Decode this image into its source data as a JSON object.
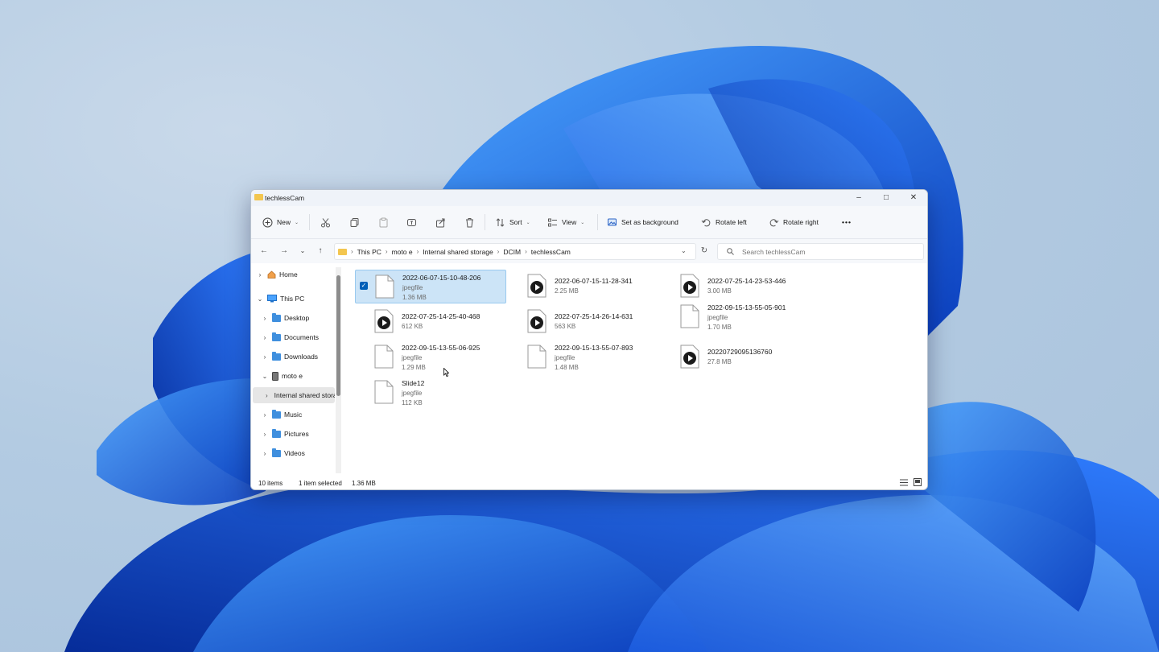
{
  "window": {
    "title": "techlessCam"
  },
  "toolbar": {
    "new_label": "New",
    "sort_label": "Sort",
    "view_label": "View",
    "set_background_label": "Set as background",
    "rotate_left_label": "Rotate left",
    "rotate_right_label": "Rotate right",
    "more_label": "•••"
  },
  "address": {
    "crumbs": [
      "This PC",
      "moto e",
      "Internal shared storage",
      "DCIM",
      "techlessCam"
    ]
  },
  "search": {
    "placeholder": "Search techlessCam"
  },
  "sidebar": {
    "items": [
      {
        "label": "Home",
        "icon": "home-icon"
      },
      {
        "label": "This PC",
        "icon": "computer-icon"
      },
      {
        "label": "Desktop",
        "icon": "folder-icon"
      },
      {
        "label": "Documents",
        "icon": "folder-icon"
      },
      {
        "label": "Downloads",
        "icon": "folder-icon"
      },
      {
        "label": "moto e",
        "icon": "phone-icon"
      },
      {
        "label": "Internal shared storage",
        "icon": "storage-icon"
      },
      {
        "label": "Music",
        "icon": "folder-icon"
      },
      {
        "label": "Pictures",
        "icon": "folder-icon"
      },
      {
        "label": "Videos",
        "icon": "folder-icon"
      }
    ]
  },
  "files": [
    {
      "name": "2022-06-07-15-10-48-206",
      "type": "jpegfile",
      "size": "1.36 MB",
      "kind": "image",
      "selected": true
    },
    {
      "name": "2022-06-07-15-11-28-341",
      "type": "",
      "size": "2.25 MB",
      "kind": "video"
    },
    {
      "name": "2022-07-25-14-23-53-446",
      "type": "",
      "size": "3.00 MB",
      "kind": "video"
    },
    {
      "name": "2022-07-25-14-25-40-468",
      "type": "",
      "size": "612 KB",
      "kind": "video"
    },
    {
      "name": "2022-07-25-14-26-14-631",
      "type": "",
      "size": "563 KB",
      "kind": "video"
    },
    {
      "name": "2022-09-15-13-55-05-901",
      "type": "jpegfile",
      "size": "1.70 MB",
      "kind": "image"
    },
    {
      "name": "2022-09-15-13-55-06-925",
      "type": "jpegfile",
      "size": "1.29 MB",
      "kind": "image"
    },
    {
      "name": "2022-09-15-13-55-07-893",
      "type": "jpegfile",
      "size": "1.48 MB",
      "kind": "image"
    },
    {
      "name": "20220729095136760",
      "type": "",
      "size": "27.8 MB",
      "kind": "video"
    },
    {
      "name": "Slide12",
      "type": "jpegfile",
      "size": "112 KB",
      "kind": "image"
    }
  ],
  "status": {
    "items": "10 items",
    "selected": "1 item selected",
    "size": "1.36 MB"
  },
  "colors": {
    "accent": "#005fb8",
    "selection": "#cce4f7",
    "folder": "#3f8fde"
  }
}
